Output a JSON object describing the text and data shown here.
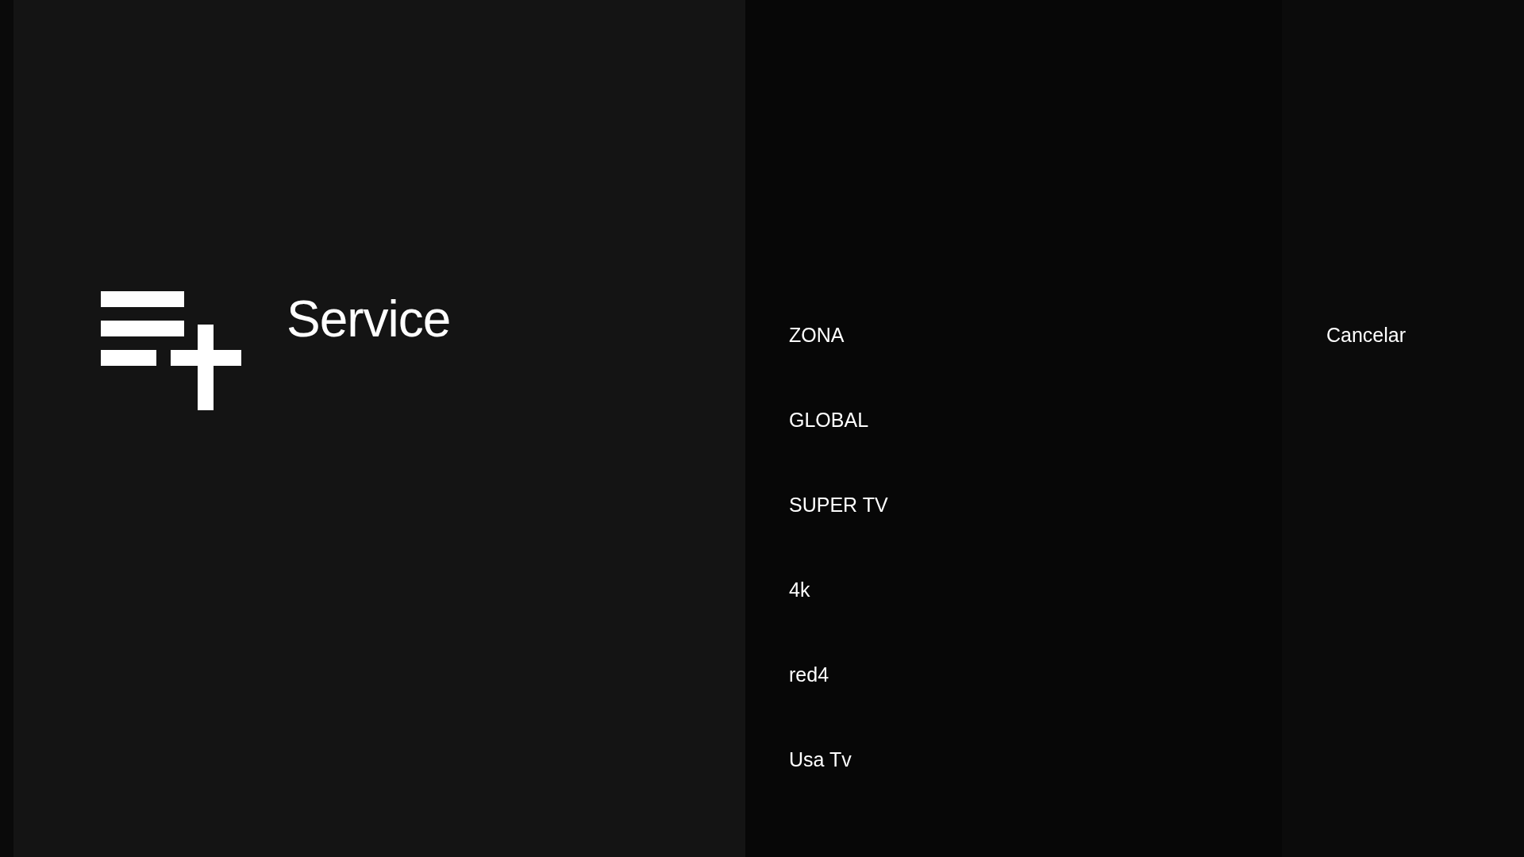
{
  "header": {
    "title": "Service"
  },
  "options": [
    "ZONA",
    "GLOBAL",
    "SUPER TV",
    "4k",
    "red4",
    "Usa Tv"
  ],
  "actions": [
    "Cancelar"
  ]
}
